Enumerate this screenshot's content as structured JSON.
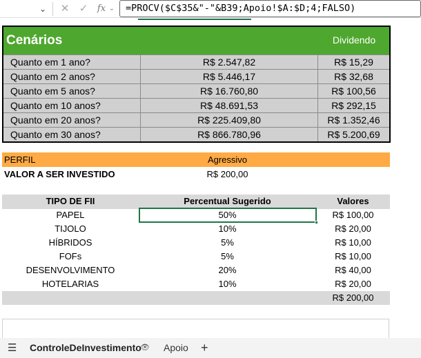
{
  "formula_bar": {
    "dropdown_icon": "chevron-down-icon",
    "cancel_icon": "close-icon",
    "confirm_icon": "check-icon",
    "fx_label": "fx",
    "formula": "=PROCV($C$35&\"-\"&B39;Apoio!$A:$D;4;FALSO)"
  },
  "scenarios": {
    "title": "Cenários",
    "dividend_header": "Dividendo",
    "rows": [
      {
        "label": "Quanto em 1 ano?",
        "total": "R$ 2.547,82",
        "dividend": "R$ 15,29"
      },
      {
        "label": "Quanto em 2 anos?",
        "total": "R$ 5.446,17",
        "dividend": "R$ 32,68"
      },
      {
        "label": "Quanto em 5 anos?",
        "total": "R$ 16.760,80",
        "dividend": "R$ 100,56"
      },
      {
        "label": "Quanto em 10 anos?",
        "total": "R$ 48.691,53",
        "dividend": "R$ 292,15"
      },
      {
        "label": "Quanto em 20 anos?",
        "total": "R$ 225.409,80",
        "dividend": "R$ 1.352,46"
      },
      {
        "label": "Quanto em 30 anos?",
        "total": "R$ 866.780,96",
        "dividend": "R$ 5.200,69"
      }
    ]
  },
  "profile": {
    "label": "PERFIL",
    "value": "Agressivo",
    "invest_label": "VALOR A SER INVESTIDO",
    "invest_value": "R$ 200,00"
  },
  "allocation": {
    "headers": [
      "TIPO DE FII",
      "Percentual Sugerido",
      "Valores"
    ],
    "rows": [
      {
        "type": "PAPEL",
        "pct": "50%",
        "value": "R$ 100,00"
      },
      {
        "type": "TIJOLO",
        "pct": "10%",
        "value": "R$ 20,00"
      },
      {
        "type": "HÍBRIDOS",
        "pct": "5%",
        "value": "R$ 10,00"
      },
      {
        "type": "FOFs",
        "pct": "5%",
        "value": "R$ 10,00"
      },
      {
        "type": "DESENVOLVIMENTO",
        "pct": "20%",
        "value": "R$ 40,00"
      },
      {
        "type": "HOTELARIAS",
        "pct": "10%",
        "value": "R$ 20,00"
      }
    ],
    "total": "R$ 200,00"
  },
  "sheet_tabs": {
    "menu_icon": "hamburger-menu-icon",
    "active": "ControleDeInvestimento",
    "active_icon": "eye-icon",
    "other": "Apoio",
    "add_icon": "plus-icon"
  }
}
